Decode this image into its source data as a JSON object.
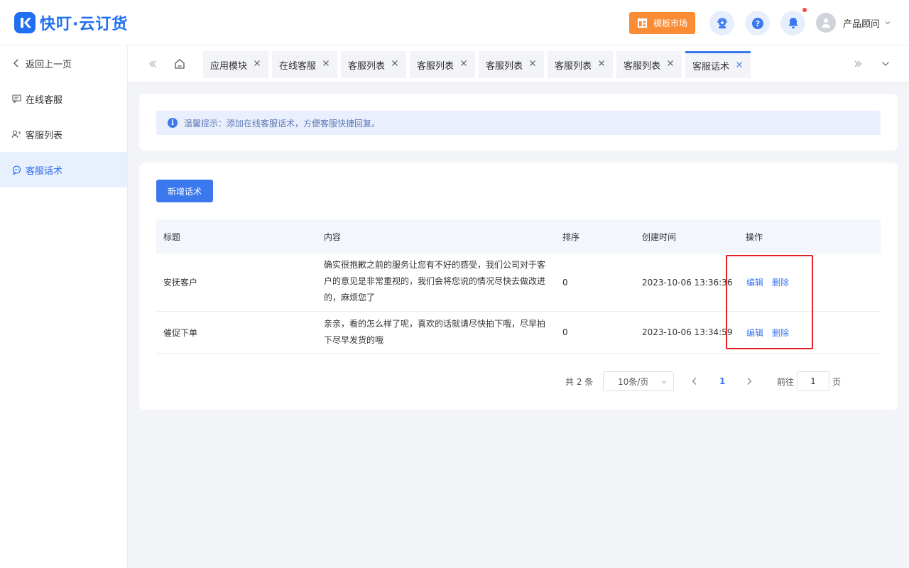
{
  "header": {
    "logo_text": "快叮·云订货",
    "template_market": "模板市场",
    "user_name": "产品顾问",
    "icons": [
      "customer-service-icon",
      "help-icon",
      "bell-icon",
      "user-avatar-icon"
    ],
    "accent": "#fa8c35"
  },
  "sidebar": {
    "back_label": "返回上一页",
    "items": [
      {
        "label": "在线客服",
        "icon": "chat-icon"
      },
      {
        "label": "客服列表",
        "icon": "users-icon"
      },
      {
        "label": "客服话术",
        "icon": "message-icon",
        "active": true
      }
    ]
  },
  "tabs": [
    {
      "label": "应用模块"
    },
    {
      "label": "在线客服"
    },
    {
      "label": "客服列表"
    },
    {
      "label": "客服列表"
    },
    {
      "label": "客服列表"
    },
    {
      "label": "客服列表"
    },
    {
      "label": "客服列表"
    },
    {
      "label": "客服话术",
      "active": true
    }
  ],
  "tip": {
    "text": "温馨提示：添加在线客服话术，方便客服快捷回复。"
  },
  "toolbar": {
    "add_label": "新增话术"
  },
  "table": {
    "columns": [
      "标题",
      "内容",
      "排序",
      "创建时间",
      "操作"
    ],
    "rows": [
      {
        "title": "安抚客户",
        "content_lines": [
          "确实很抱歉之前的服务让您有不好的感受，我们公司对于客",
          "户的意见是非常重视的，我们会将您说的情况尽快去做改进",
          "的，麻烦您了"
        ],
        "sort": "0",
        "created": "2023-10-06 13:36:36",
        "edit": "编辑",
        "delete": "删除"
      },
      {
        "title": "催促下单",
        "content_lines": [
          "亲亲，看的怎么样了呢，喜欢的话就请尽快拍下哦，尽早拍",
          "下尽早发货的哦"
        ],
        "sort": "0",
        "created": "2023-10-06 13:34:59",
        "edit": "编辑",
        "delete": "删除"
      }
    ]
  },
  "pagination": {
    "total": "共 2 条",
    "page_size": "10条/页",
    "current_page": "1",
    "goto_label": "前往",
    "goto_value": "1",
    "page_suffix": "页"
  },
  "colors": {
    "primary": "#3b78ee",
    "highlight_box": "#e22222"
  }
}
